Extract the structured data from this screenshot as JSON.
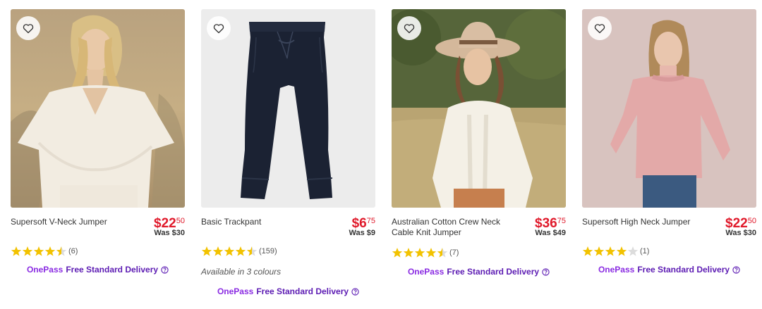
{
  "colors": {
    "price": "#e01a2b",
    "star": "#f2c200",
    "star_empty": "#dcdcdc",
    "onepass": "#8a2be2",
    "delivery_text": "#5c1bb3"
  },
  "products": [
    {
      "name": "Supersoft V-Neck Jumper",
      "price_dollars": "$22",
      "price_cents": "50",
      "was": "Was $30",
      "rating": 4.5,
      "reviews": "(6)",
      "colours": "",
      "onepass": "OnePass",
      "delivery": "Free Standard Delivery",
      "icons": [
        "heart-outline-icon",
        "help-circle-icon"
      ]
    },
    {
      "name": "Basic Trackpant",
      "price_dollars": "$6",
      "price_cents": "75",
      "was": "Was $9",
      "rating": 4.5,
      "reviews": "(159)",
      "colours": "Available in 3 colours",
      "onepass": "OnePass",
      "delivery": "Free Standard Delivery",
      "icons": [
        "heart-outline-icon",
        "help-circle-icon"
      ]
    },
    {
      "name": "Australian Cotton Crew Neck Cable Knit Jumper",
      "price_dollars": "$36",
      "price_cents": "75",
      "was": "Was $49",
      "rating": 4.5,
      "reviews": "(7)",
      "colours": "",
      "onepass": "OnePass",
      "delivery": "Free Standard Delivery",
      "icons": [
        "heart-outline-icon",
        "help-circle-icon"
      ]
    },
    {
      "name": "Supersoft High Neck Jumper",
      "price_dollars": "$22",
      "price_cents": "50",
      "was": "Was $30",
      "rating": 4,
      "reviews": "(1)",
      "colours": "",
      "onepass": "OnePass",
      "delivery": "Free Standard Delivery",
      "icons": [
        "heart-outline-icon",
        "help-circle-icon"
      ]
    }
  ]
}
